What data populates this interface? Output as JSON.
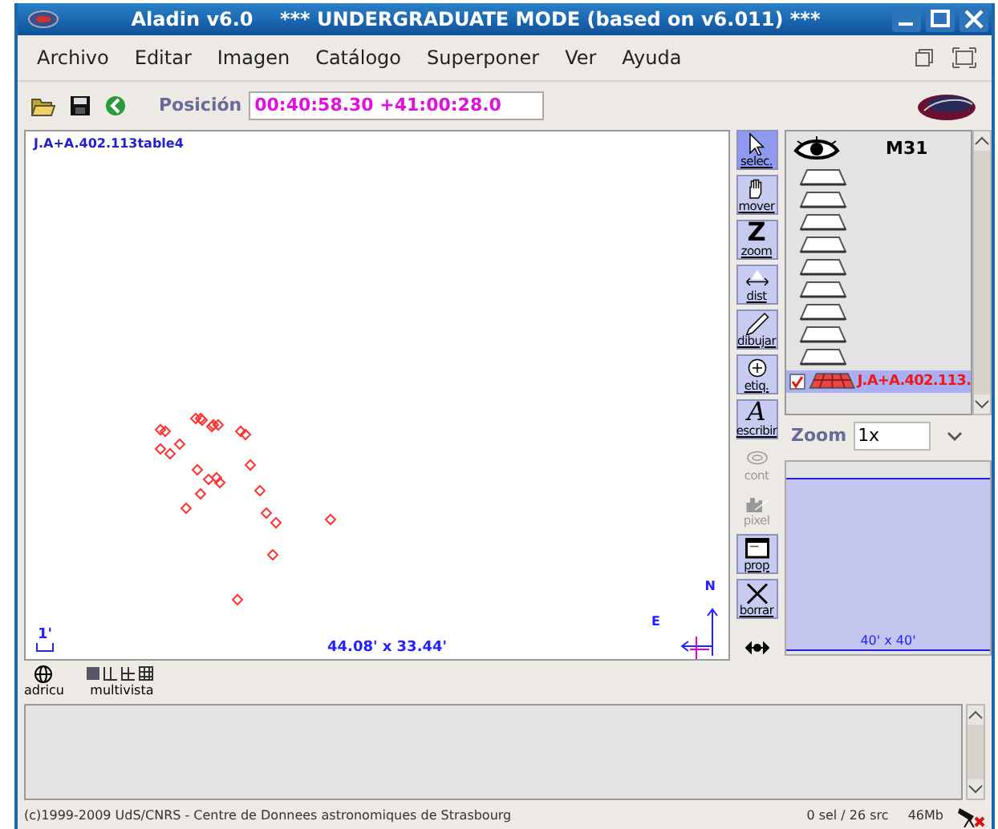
{
  "window": {
    "title": "Aladin v6.0    *** UNDERGRADUATE MODE (based on v6.011) ***"
  },
  "menu": [
    "Archivo",
    "Editar",
    "Imagen",
    "Catálogo",
    "Superponer",
    "Ver",
    "Ayuda"
  ],
  "toolbar": {
    "position_label": "Posición",
    "position_value": "00:40:58.30 +41:00:28.0"
  },
  "view": {
    "plane_label": "J.A+A.402.113table4",
    "scale": "1'",
    "size": "44.08' x 33.44'",
    "north": "N",
    "east": "E"
  },
  "tools": [
    {
      "kind": "select",
      "label": "selec.",
      "selected": true,
      "disabled": false
    },
    {
      "kind": "pan",
      "label": "mover",
      "selected": false,
      "disabled": false
    },
    {
      "kind": "zoom",
      "label": "zoom",
      "glyph": "Z",
      "selected": false,
      "disabled": false
    },
    {
      "kind": "dist",
      "label": "dist",
      "selected": false,
      "disabled": false
    },
    {
      "kind": "draw",
      "label": "dibujar",
      "selected": false,
      "disabled": false
    },
    {
      "kind": "tag",
      "label": "etiq.",
      "selected": false,
      "disabled": false
    },
    {
      "kind": "write",
      "label": "escribir",
      "glyph": "A",
      "selected": false,
      "disabled": false
    },
    {
      "kind": "contour",
      "label": "cont",
      "selected": false,
      "disabled": true
    },
    {
      "kind": "pixel",
      "label": "pixel",
      "selected": false,
      "disabled": true
    },
    {
      "kind": "prop",
      "label": "prop",
      "selected": false,
      "disabled": false
    },
    {
      "kind": "delete",
      "label": "borrar",
      "selected": false,
      "disabled": false
    }
  ],
  "stack": {
    "title": "M31",
    "planes": [
      {
        "kind": "empty",
        "selected": false
      },
      {
        "kind": "empty",
        "selected": false
      },
      {
        "kind": "empty",
        "selected": false
      },
      {
        "kind": "empty",
        "selected": false
      },
      {
        "kind": "empty",
        "selected": false
      },
      {
        "kind": "empty",
        "selected": false
      },
      {
        "kind": "empty",
        "selected": false
      },
      {
        "kind": "empty",
        "selected": false
      },
      {
        "kind": "empty",
        "selected": false
      },
      {
        "kind": "catalog",
        "label": "J.A+A.402.113.",
        "checked": true,
        "selected": true
      }
    ]
  },
  "zoom": {
    "label": "Zoom",
    "value": "1x",
    "preview_size": "40' x 40'"
  },
  "view_modes": [
    {
      "kind": "grid",
      "label": "adricu"
    },
    {
      "kind": "multiview",
      "label": "multivista"
    }
  ],
  "status": {
    "copyright": "(c)1999-2009 UdS/CNRS - Centre de Donnees astronomiques de Strasbourg",
    "selection": "0 sel / 26 src",
    "memory": "46Mb"
  }
}
